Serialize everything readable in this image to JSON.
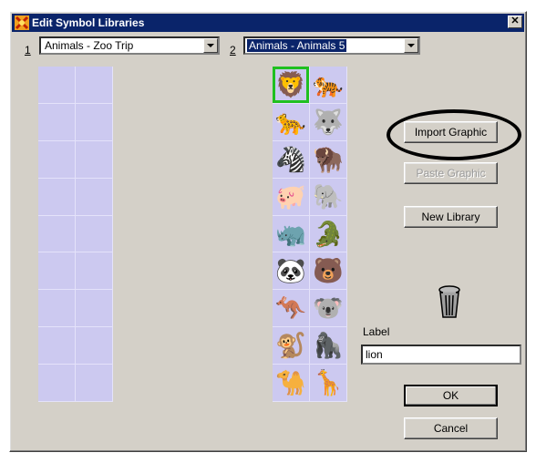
{
  "window": {
    "title": "Edit Symbol Libraries"
  },
  "lib1": {
    "number": "1",
    "selected": "Animals  - Zoo Trip"
  },
  "lib2": {
    "number": "2",
    "selected": "Animals  - Animals 5"
  },
  "library2_symbols": [
    {
      "name": "lion",
      "glyph": "🦁"
    },
    {
      "name": "tiger",
      "glyph": "🐅"
    },
    {
      "name": "cougar",
      "glyph": "🐆"
    },
    {
      "name": "wolf",
      "glyph": "🐺"
    },
    {
      "name": "zebra",
      "glyph": "🦓"
    },
    {
      "name": "bison",
      "glyph": "🦬"
    },
    {
      "name": "pig",
      "glyph": "🐖"
    },
    {
      "name": "elephant",
      "glyph": "🐘"
    },
    {
      "name": "rhino",
      "glyph": "🦏"
    },
    {
      "name": "alligator",
      "glyph": "🐊"
    },
    {
      "name": "panda",
      "glyph": "🐼"
    },
    {
      "name": "bear",
      "glyph": "🐻"
    },
    {
      "name": "kangaroo",
      "glyph": "🦘"
    },
    {
      "name": "koala",
      "glyph": "🐨"
    },
    {
      "name": "monkey",
      "glyph": "🐒"
    },
    {
      "name": "gorilla",
      "glyph": "🦍"
    },
    {
      "name": "camel",
      "glyph": "🐪"
    },
    {
      "name": "giraffe",
      "glyph": "🦒"
    }
  ],
  "buttons": {
    "import_graphic": "Import Graphic",
    "paste_graphic": "Paste Graphic",
    "new_library": "New Library",
    "ok": "OK",
    "cancel": "Cancel"
  },
  "label_field": {
    "caption": "Label",
    "value": "lion"
  },
  "colors": {
    "grid_bg": "#ccc9f0",
    "selection": "#20c020",
    "titlebar": "#0a246a"
  },
  "icons": {
    "trash": "trash-can-icon"
  }
}
